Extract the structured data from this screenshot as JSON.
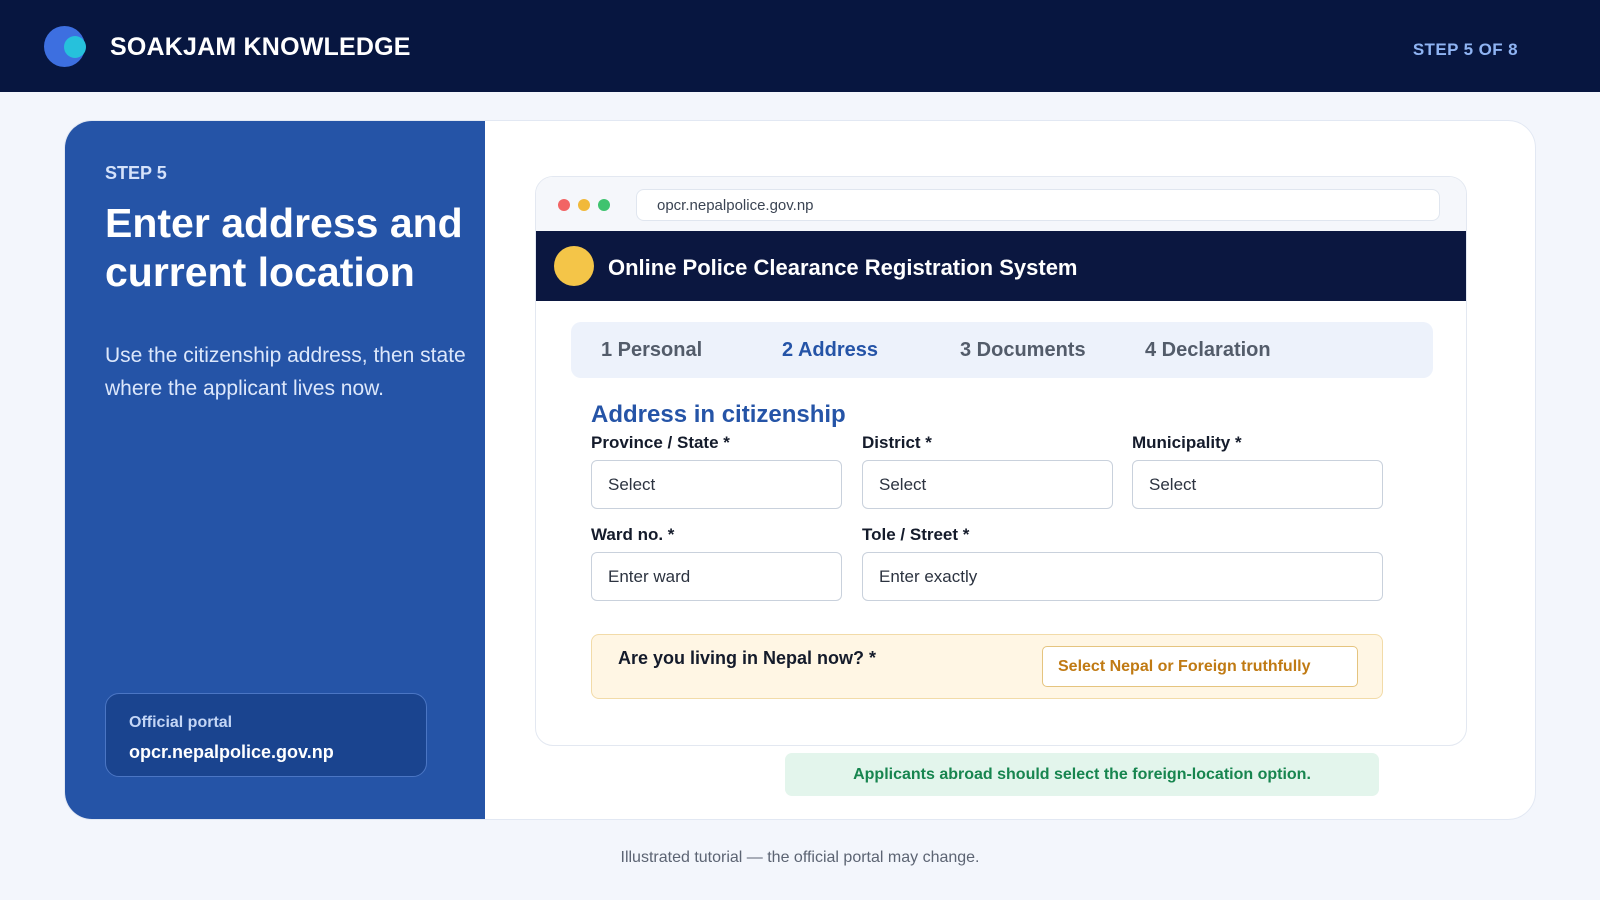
{
  "header": {
    "brand": "SOAKJAM KNOWLEDGE",
    "step_count": "STEP 5 OF 8"
  },
  "left_panel": {
    "step_label": "STEP 5",
    "title": "Enter address and current location",
    "description": "Use the citizenship address, then state where the applicant lives now.",
    "portal_label": "Official portal",
    "portal_url": "opcr.nepalpolice.gov.np"
  },
  "browser": {
    "url": "opcr.nepalpolice.gov.np",
    "site_title": "Online Police Clearance Registration System",
    "tabs": [
      {
        "label": "1 Personal",
        "active": false
      },
      {
        "label": "2 Address",
        "active": true
      },
      {
        "label": "3 Documents",
        "active": false
      },
      {
        "label": "4 Declaration",
        "active": false
      }
    ],
    "section_title": "Address in citizenship",
    "fields": {
      "province": {
        "label": "Province / State *",
        "value": "Select"
      },
      "district": {
        "label": "District *",
        "value": "Select"
      },
      "municipality": {
        "label": "Municipality *",
        "value": "Select"
      },
      "ward": {
        "label": "Ward no. *",
        "placeholder": "Enter ward"
      },
      "tole": {
        "label": "Tole / Street *",
        "placeholder": "Enter exactly"
      }
    },
    "living": {
      "question": "Are you living in Nepal now? *",
      "value": "Select Nepal or Foreign truthfully"
    }
  },
  "note": "Applicants abroad should select the foreign-location option.",
  "footer": "Illustrated tutorial — the official portal may change.",
  "colors": {
    "navy": "#071640",
    "panel_blue": "#2554a7",
    "accent_blue": "#3d6fe0",
    "accent_cyan": "#26c1dc",
    "warning_bg": "#fff6e4",
    "warning_text": "#c07a13",
    "success_bg": "#e3f5ec",
    "success_text": "#17854f"
  }
}
